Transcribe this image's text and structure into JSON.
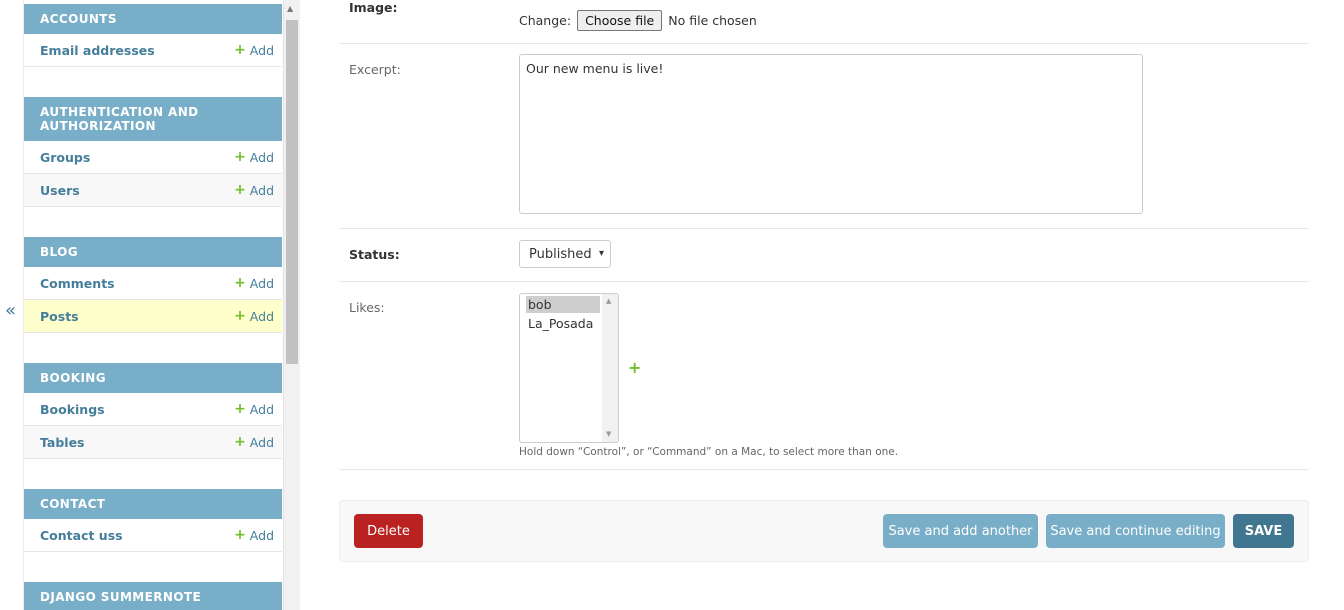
{
  "sidebar": {
    "collapse_glyph": "«",
    "add_label": "Add",
    "modules": [
      {
        "header": "ACCOUNTS",
        "items": [
          {
            "label": "Email addresses"
          }
        ]
      },
      {
        "header": "AUTHENTICATION AND AUTHORIZATION",
        "items": [
          {
            "label": "Groups"
          },
          {
            "label": "Users"
          }
        ]
      },
      {
        "header": "BLOG",
        "items": [
          {
            "label": "Comments"
          },
          {
            "label": "Posts"
          }
        ]
      },
      {
        "header": "BOOKING",
        "items": [
          {
            "label": "Bookings"
          },
          {
            "label": "Tables"
          }
        ]
      },
      {
        "header": "CONTACT",
        "items": [
          {
            "label": "Contact uss"
          }
        ]
      },
      {
        "header": "DJANGO SUMMERNOTE",
        "items": []
      }
    ]
  },
  "form": {
    "image": {
      "label": "Image:",
      "change_label": "Change:",
      "choose_button": "Choose file",
      "no_file": "No file chosen"
    },
    "excerpt": {
      "label": "Excerpt:",
      "value": "Our new menu is live!"
    },
    "status": {
      "label": "Status:",
      "selected": "Published"
    },
    "likes": {
      "label": "Likes:",
      "options": [
        "bob",
        "La_Posada"
      ],
      "selected": "bob",
      "help": "Hold down “Control”, or “Command” on a Mac, to select more than one."
    }
  },
  "submit": {
    "delete": "Delete",
    "save_add_another": "Save and add another",
    "save_continue": "Save and continue editing",
    "save": "SAVE"
  },
  "colors": {
    "module_header": "#79aec8",
    "link": "#447e9b",
    "add_plus": "#70bf2b",
    "delete": "#ba2121",
    "save": "#417690",
    "selected_row": "#ffffcc"
  }
}
